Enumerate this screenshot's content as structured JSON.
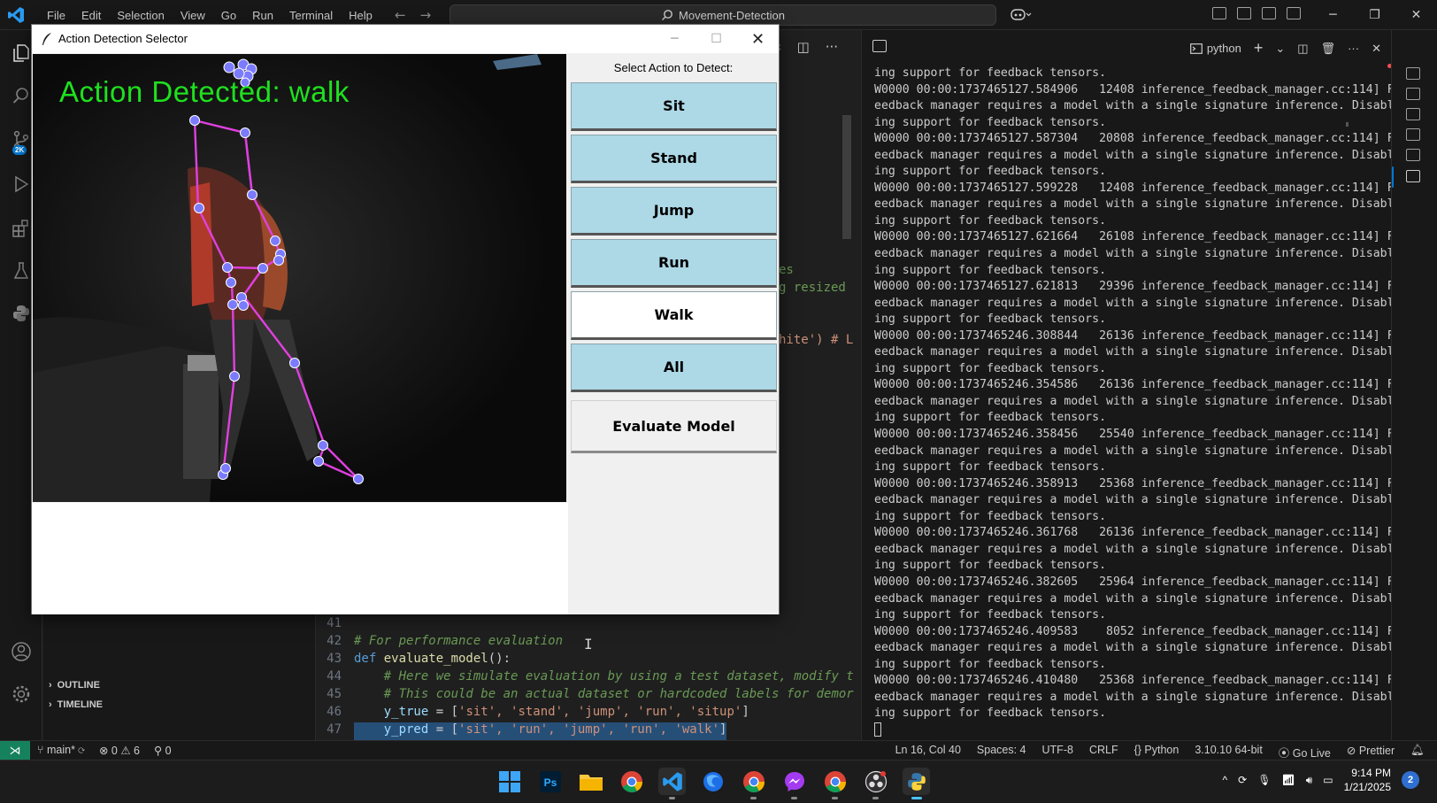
{
  "vscode": {
    "menu": [
      "File",
      "Edit",
      "Selection",
      "View",
      "Go",
      "Run",
      "Terminal",
      "Help"
    ],
    "nav": {
      "back": "←",
      "forward": "→"
    },
    "search": "Movement-Detection",
    "window_controls": {
      "min": "─",
      "max": "❐",
      "close": "✕"
    },
    "sidebar": {
      "outline": "OUTLINE",
      "timeline": "TIMELINE",
      "badge": "2K"
    },
    "editor_peek": {
      "frag1": "es",
      "frag2": "g resized",
      "frag3": "hite')  # L"
    },
    "code_lines": [
      {
        "num": "41",
        "text": ""
      },
      {
        "num": "42",
        "text": "# For performance evaluation"
      },
      {
        "num": "43",
        "kw": "def ",
        "fn": "evaluate_model",
        "rest": "():"
      },
      {
        "num": "44",
        "text": "    # Here we simulate evaluation by using a test dataset, modify t"
      },
      {
        "num": "45",
        "text": "    # This could be an actual dataset or hardcoded labels for demor"
      },
      {
        "num": "46",
        "var": "    y_true",
        "eq": " = [",
        "items": "'sit', 'stand', 'jump', 'run', 'situp'",
        "end": "]"
      },
      {
        "num": "47",
        "var": "    y_pred",
        "eq": " = [",
        "items": "'sit', 'run', 'jump', 'run', 'walk'",
        "end": "]"
      }
    ]
  },
  "terminal": {
    "shell": "python",
    "add": "+",
    "more": "···",
    "close": "✕",
    "lines": [
      "ing support for feedback tensors.",
      "W0000 00:00:1737465127.584906   12408 inference_feedback_manager.cc:114] F",
      "eedback manager requires a model with a single signature inference. Disabl",
      "ing support for feedback tensors.",
      "W0000 00:00:1737465127.587304   20808 inference_feedback_manager.cc:114] F",
      "eedback manager requires a model with a single signature inference. Disabl",
      "ing support for feedback tensors.",
      "W0000 00:00:1737465127.599228   12408 inference_feedback_manager.cc:114] F",
      "eedback manager requires a model with a single signature inference. Disabl",
      "ing support for feedback tensors.",
      "W0000 00:00:1737465127.621664   26108 inference_feedback_manager.cc:114] F",
      "eedback manager requires a model with a single signature inference. Disabl",
      "ing support for feedback tensors.",
      "W0000 00:00:1737465127.621813   29396 inference_feedback_manager.cc:114] F",
      "eedback manager requires a model with a single signature inference. Disabl",
      "ing support for feedback tensors.",
      "W0000 00:00:1737465246.308844   26136 inference_feedback_manager.cc:114] F",
      "eedback manager requires a model with a single signature inference. Disabl",
      "ing support for feedback tensors.",
      "W0000 00:00:1737465246.354586   26136 inference_feedback_manager.cc:114] F",
      "eedback manager requires a model with a single signature inference. Disabl",
      "ing support for feedback tensors.",
      "W0000 00:00:1737465246.358456   25540 inference_feedback_manager.cc:114] F",
      "eedback manager requires a model with a single signature inference. Disabl",
      "ing support for feedback tensors.",
      "W0000 00:00:1737465246.358913   25368 inference_feedback_manager.cc:114] F",
      "eedback manager requires a model with a single signature inference. Disabl",
      "ing support for feedback tensors.",
      "W0000 00:00:1737465246.361768   26136 inference_feedback_manager.cc:114] F",
      "eedback manager requires a model with a single signature inference. Disabl",
      "ing support for feedback tensors.",
      "W0000 00:00:1737465246.382605   25964 inference_feedback_manager.cc:114] F",
      "eedback manager requires a model with a single signature inference. Disabl",
      "ing support for feedback tensors.",
      "W0000 00:00:1737465246.409583    8052 inference_feedback_manager.cc:114] F",
      "eedback manager requires a model with a single signature inference. Disabl",
      "ing support for feedback tensors.",
      "W0000 00:00:1737465246.410480   25368 inference_feedback_manager.cc:114] F",
      "eedback manager requires a model with a single signature inference. Disabl",
      "ing support for feedback tensors."
    ]
  },
  "statusbar": {
    "branch": "main*",
    "errors": "0",
    "warnings": "6",
    "ports": "0",
    "position": "Ln 16, Col 40",
    "spaces": "Spaces: 4",
    "encoding": "UTF-8",
    "eol": "CRLF",
    "language": "Python",
    "interpreter": "3.10.10 64-bit",
    "golive": "Go Live",
    "prettier": "Prettier"
  },
  "taskbar": {
    "time": "9:14 PM",
    "date": "1/21/2025",
    "notifications": "2",
    "apps": [
      "windows-start",
      "photoshop",
      "file-explorer",
      "chrome",
      "vscode",
      "firefox",
      "chrome-alt",
      "messenger",
      "chrome-profile",
      "obs",
      "python-tk"
    ]
  },
  "tk_window": {
    "title": "Action Detection Selector",
    "controls": {
      "min": "─",
      "max": "☐",
      "close": "✕"
    },
    "overlay_text": "Action Detected: walk",
    "panel_label": "Select Action to Detect:",
    "buttons": [
      "Sit",
      "Stand",
      "Jump",
      "Run",
      "Walk",
      "All",
      "Evaluate Model"
    ],
    "selected_button": "Walk",
    "colors": {
      "button": "#add8e6",
      "selected": "#ffffff",
      "overlay": "#1fe01f",
      "skeleton": "#e040e0",
      "joints": "#7b7bff"
    }
  }
}
